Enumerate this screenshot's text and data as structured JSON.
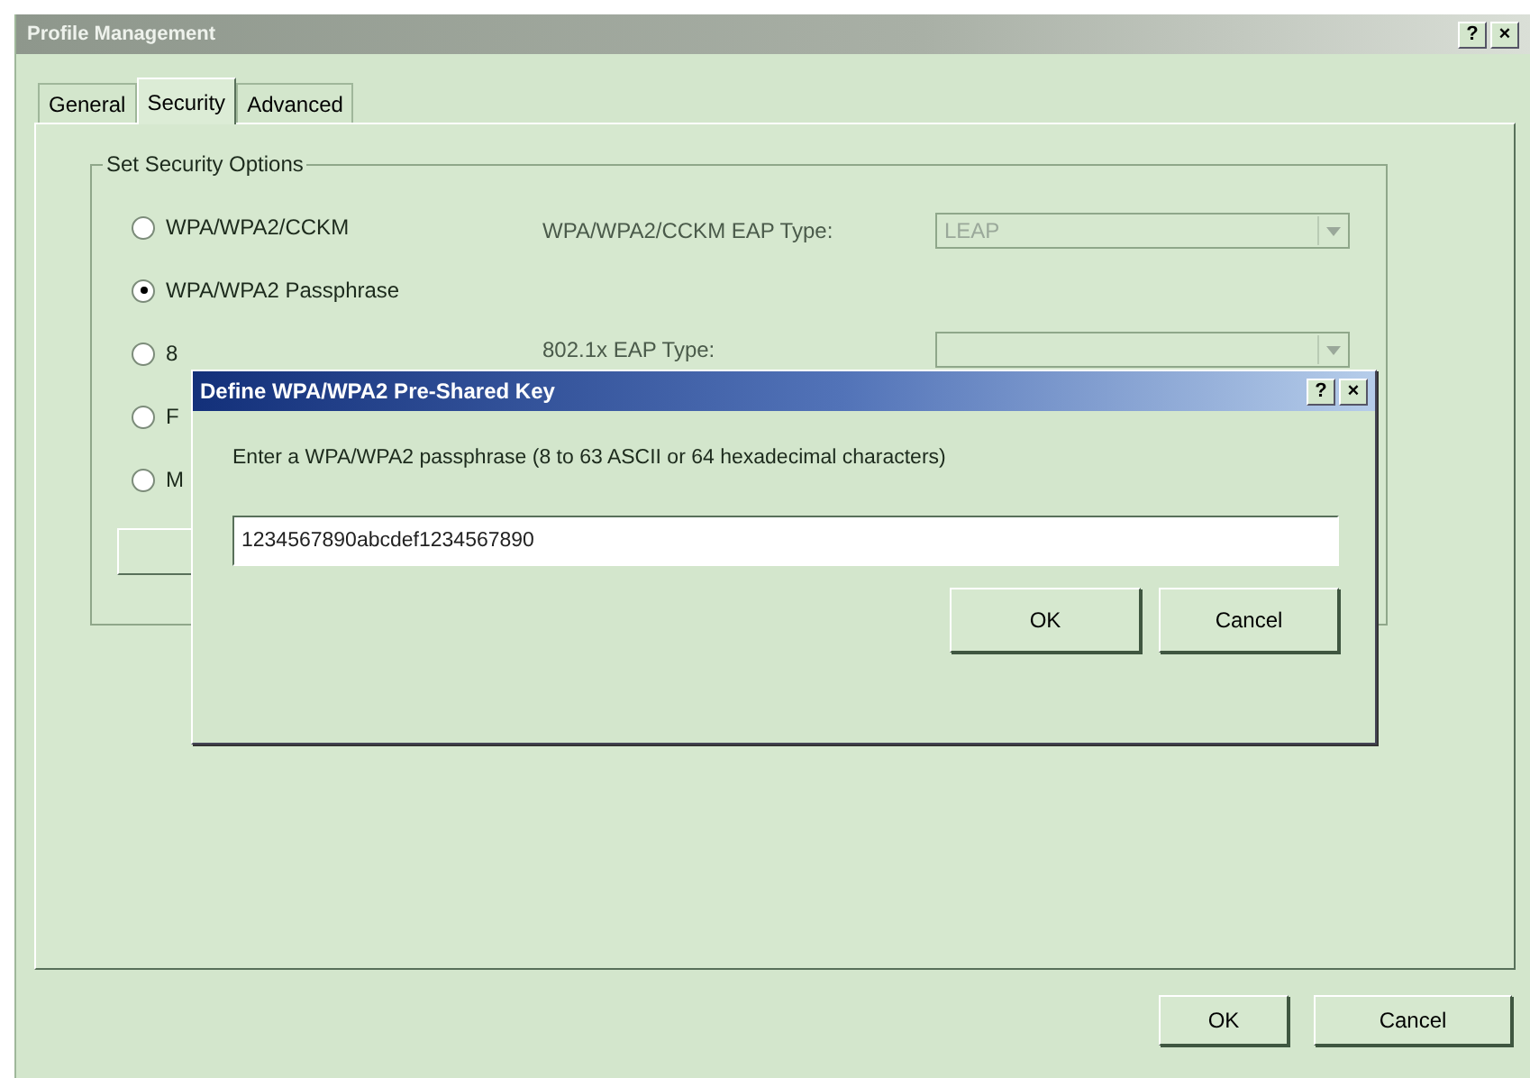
{
  "window": {
    "title": "Profile Management",
    "help": "?",
    "close": "×"
  },
  "tabs": [
    {
      "label": "General",
      "selected": false
    },
    {
      "label": "Security",
      "selected": true
    },
    {
      "label": "Advanced",
      "selected": false
    }
  ],
  "group": {
    "title": "Set Security Options",
    "options": [
      {
        "label": "WPA/WPA2/CCKM",
        "selected": false
      },
      {
        "label": "WPA/WPA2 Passphrase",
        "selected": true
      },
      {
        "label": "8",
        "selected": false
      },
      {
        "label": "F",
        "selected": false
      },
      {
        "label": "M",
        "selected": false
      }
    ],
    "eap_types": [
      {
        "label": "WPA/WPA2/CCKM EAP Type:",
        "value": "LEAP",
        "disabled": true
      },
      {
        "label": "802.1x EAP Type:",
        "disabled": true
      }
    ]
  },
  "dialog": {
    "title": "Define WPA/WPA2 Pre-Shared Key",
    "help": "?",
    "close": "×",
    "prompt": "Enter a WPA/WPA2 passphrase (8 to 63 ASCII or 64 hexadecimal characters)",
    "passphrase": {
      "value": "1234567890abcdef1234567890"
    },
    "buttons": [
      "OK",
      "Cancel"
    ]
  },
  "buttons": [
    "OK",
    "Cancel"
  ]
}
